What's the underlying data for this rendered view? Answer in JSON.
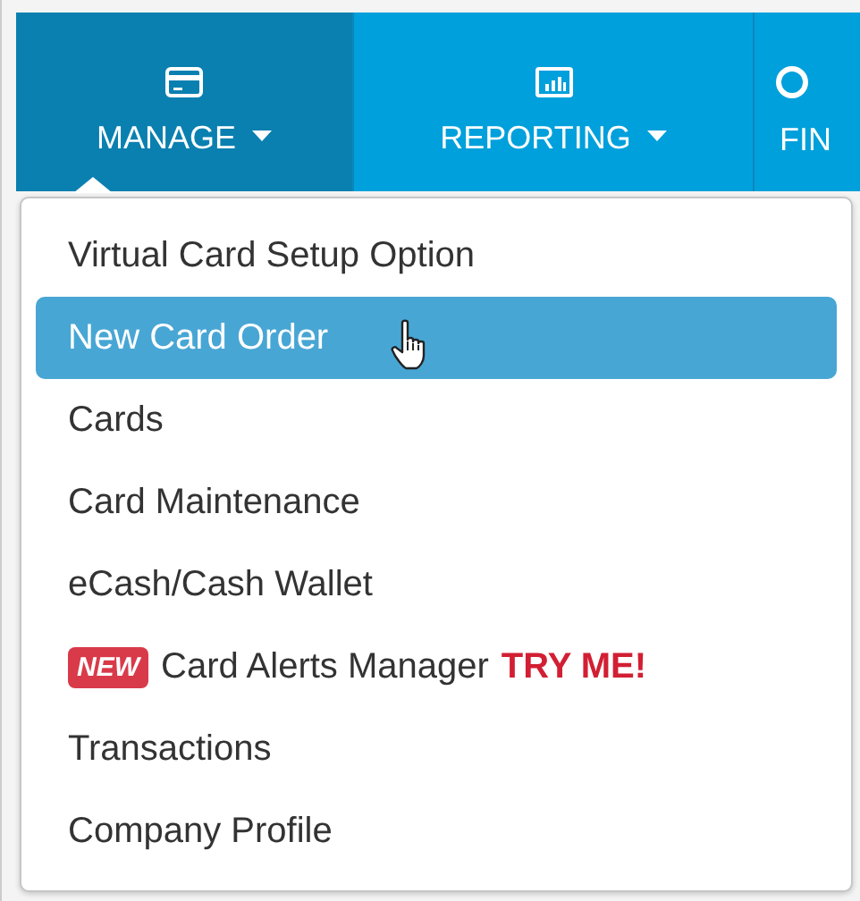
{
  "nav": [
    {
      "label": "MANAGE",
      "selected": true,
      "caret": true
    },
    {
      "label": "REPORTING",
      "selected": false,
      "caret": true
    },
    {
      "label": "FIN",
      "selected": false,
      "caret": false
    }
  ],
  "menu": [
    {
      "kind": "plain",
      "label": "Virtual Card Setup Option",
      "selected": false
    },
    {
      "kind": "plain",
      "label": "New Card Order",
      "selected": true
    },
    {
      "kind": "plain",
      "label": "Cards",
      "selected": false
    },
    {
      "kind": "plain",
      "label": "Card Maintenance",
      "selected": false
    },
    {
      "kind": "plain",
      "label": "eCash/Cash Wallet",
      "selected": false
    },
    {
      "kind": "promo",
      "badge": "NEW",
      "label": "Card Alerts Manager",
      "callout": "TRY ME!",
      "selected": false
    },
    {
      "kind": "plain",
      "label": "Transactions",
      "selected": false
    },
    {
      "kind": "plain",
      "label": "Company Profile",
      "selected": false
    }
  ]
}
